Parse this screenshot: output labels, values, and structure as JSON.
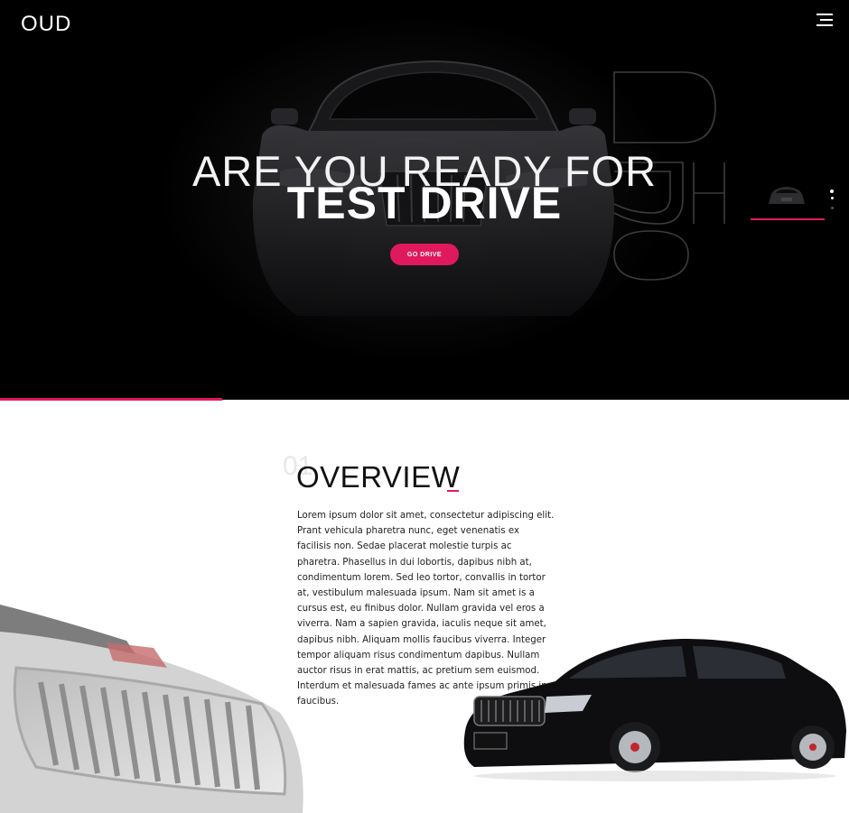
{
  "header": {
    "logo": "OUD",
    "menu_icon": "hamburger-menu-icon"
  },
  "hero": {
    "title_line1": "ARE YOU READY FOR",
    "title_line2": "TEST DRIVE",
    "cta_label": "GO DRIVE",
    "watermark": "OUD",
    "colors": {
      "accent": "#e0195d",
      "background": "#000000"
    }
  },
  "overview": {
    "number": "01",
    "title": "OVERVIEW",
    "underscore": "_",
    "body": "Lorem ipsum dolor sit amet, consectetur adipiscing elit. Prant vehicula pharetra nunc, eget venenatis ex facilisis non. Sedae placerat molestie turpis ac pharetra. Phasellus in dui lobortis, dapibus nibh at, condimentum lorem. Sed leo tortor, convallis in tortor at, vestibulum malesuada ipsum. Nam sit amet is a cursus est, eu finibus dolor. Nullam gravida vel eros a viverra. Nam a sapien gravida, iaculis neque sit amet, dapibus nibh. Aliquam mollis faucibus viverra. Integer tempor aliquam risus condimentum dapibus. Nullam auctor risus in erat mattis, ac pretium sem euismod. Interdum et malesuada fames ac ante ipsum primis in faucibus."
  }
}
